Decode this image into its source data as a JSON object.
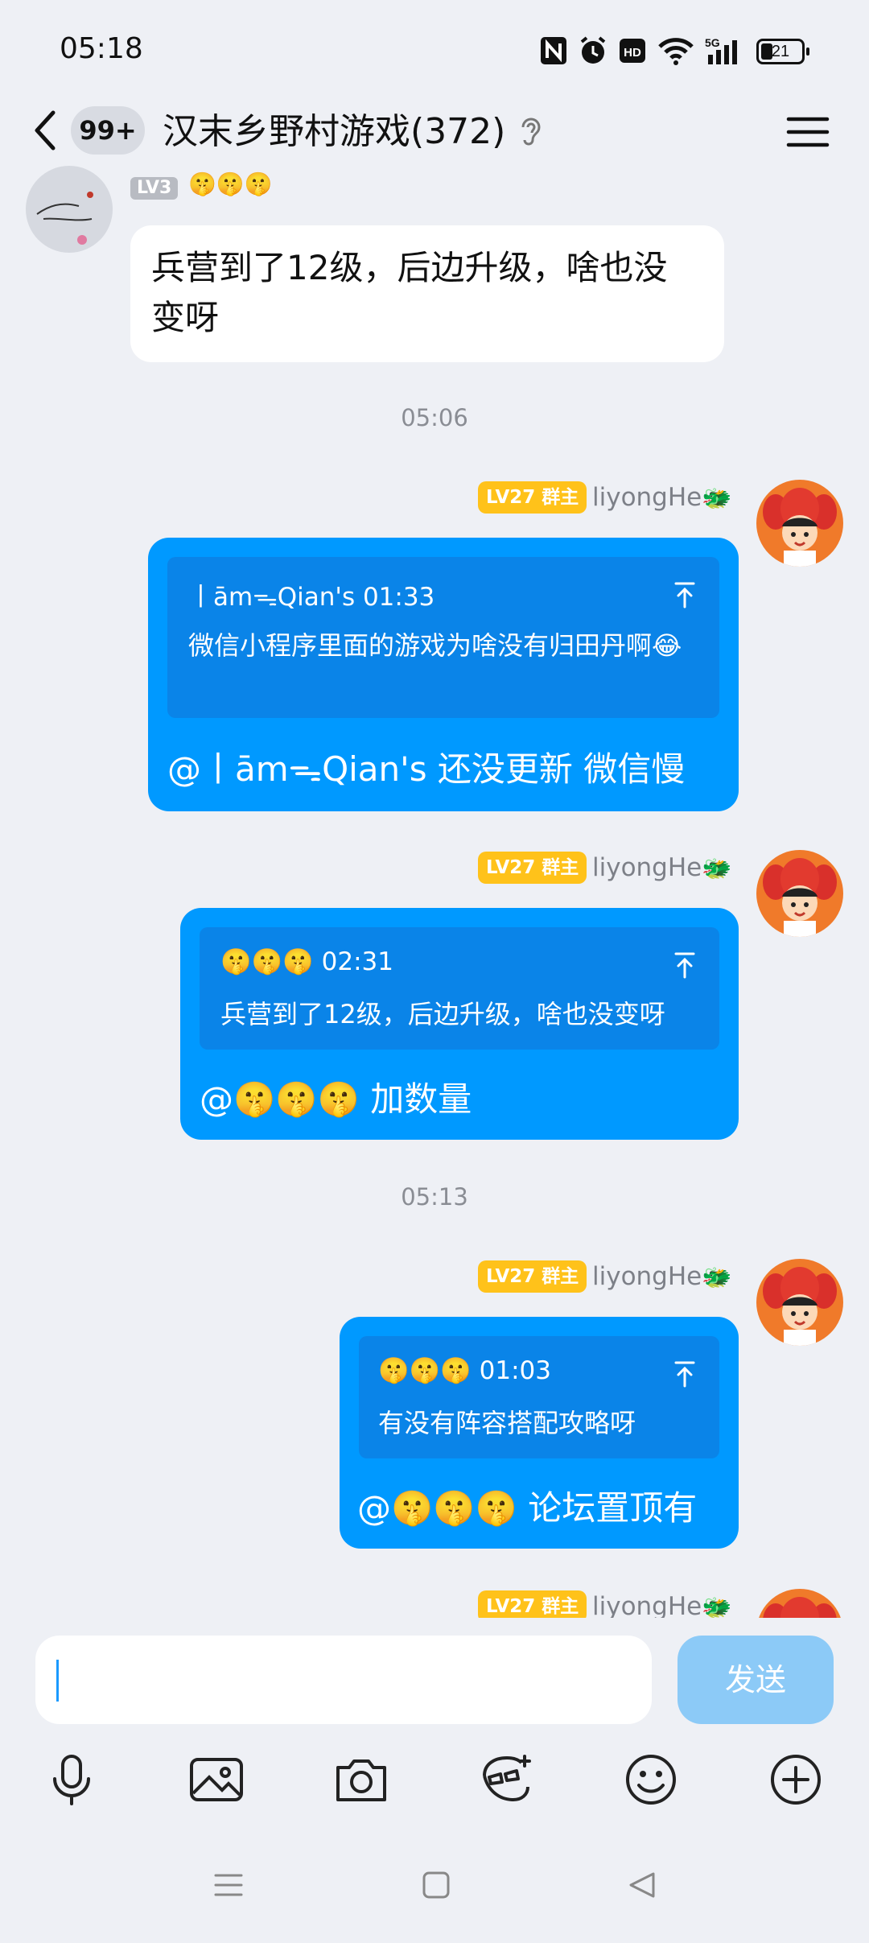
{
  "status": {
    "time": "05:18",
    "battery": "21"
  },
  "nav": {
    "unread": "99+",
    "title": "汉末乡野村游戏(372)"
  },
  "messages": {
    "m1": {
      "level": "LV3",
      "sender_emojis": "🤫🤫🤫",
      "text": "兵营到了12级，后边升级，啥也没变呀"
    },
    "ts1": "05:06",
    "m2": {
      "level": "LV27 群主",
      "sender": "liyongHe",
      "quote_head": "丨āmᯓQian's 01:33",
      "quote_body": "微信小程序里面的游戏为啥没有归田丹啊😂",
      "text": "@丨āmᯓQian's 还没更新 微信慢"
    },
    "m3": {
      "level": "LV27 群主",
      "sender": "liyongHe",
      "quote_head": "🤫🤫🤫 02:31",
      "quote_body": "兵营到了12级，后边升级，啥也没变呀",
      "text": "@🤫🤫🤫 加数量"
    },
    "ts2": "05:13",
    "m4": {
      "level": "LV27 群主",
      "sender": "liyongHe",
      "quote_head": "🤫🤫🤫 01:03",
      "quote_body": "有没有阵容搭配攻略呀",
      "text": "@🤫🤫🤫 论坛置顶有"
    },
    "m5": {
      "level": "LV27 群主",
      "sender": "liyongHe"
    }
  },
  "composer": {
    "send_label": "发送"
  },
  "icons": [
    "nfc-icon",
    "alarm-icon",
    "hd-icon",
    "wifi-icon",
    "signal-5g-icon",
    "battery-icon",
    "back-icon",
    "ear-icon",
    "menu-icon",
    "pin-top-icon",
    "mic-icon",
    "image-icon",
    "camera-icon",
    "sticker-icon",
    "emoji-icon",
    "plus-icon"
  ],
  "colors": {
    "bubble_blue": "#0099ff",
    "quote_blue": "#0a84e8",
    "level_tag": "#ffc21a",
    "send_disabled": "#8ccaf7"
  }
}
